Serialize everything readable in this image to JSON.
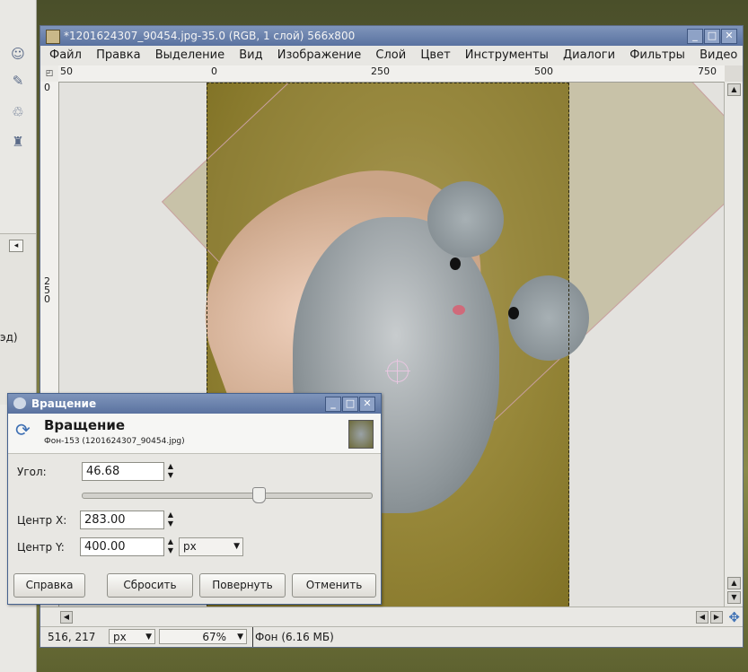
{
  "window": {
    "title": "*1201624307_90454.jpg-35.0 (RGB, 1 слой) 566x800",
    "minimize": "_",
    "maximize": "□",
    "close": "✕"
  },
  "menu": [
    "Файл",
    "Правка",
    "Выделение",
    "Вид",
    "Изображение",
    "Слой",
    "Цвет",
    "Инструменты",
    "Диалоги",
    "Фильтры",
    "Видео"
  ],
  "hruler": {
    "ticks": [
      "50",
      "0",
      "250",
      "500",
      "750"
    ]
  },
  "vruler": {
    "tick0": "0",
    "tick250": "250"
  },
  "statusbar": {
    "coords": "516, 217",
    "unit": "px",
    "zoom": "67%",
    "info": "Фон (6.16 МБ)"
  },
  "dock": {
    "text": "эд)"
  },
  "dialog": {
    "title": "Вращение",
    "header_title": "Вращение",
    "header_subtitle": "Фон-153 (1201624307_90454.jpg)",
    "angle_label": "Угол:",
    "angle_value": "46.68",
    "center_x_label": "Центр X:",
    "center_x_value": "283.00",
    "center_y_label": "Центр Y:",
    "center_y_value": "400.00",
    "unit": "px",
    "buttons": {
      "help": "Справка",
      "reset": "Сбросить",
      "rotate": "Повернуть",
      "cancel": "Отменить"
    }
  },
  "icons": {
    "toolbox": [
      "user-icon",
      "brush-icon",
      "clone-icon",
      "stamp-icon"
    ]
  },
  "colors": {
    "titlebar": "#5a72a0",
    "selection": "#2e2a12",
    "rotation_frame": "#c9a0a0"
  }
}
